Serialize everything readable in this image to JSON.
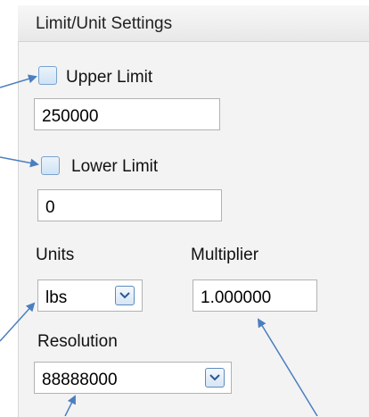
{
  "panel": {
    "title": "Limit/Unit Settings"
  },
  "upper_limit": {
    "label": "Upper Limit",
    "value": "250000",
    "checked": false
  },
  "lower_limit": {
    "label": "Lower Limit",
    "value": "0",
    "checked": false
  },
  "units": {
    "label": "Units",
    "selected": "lbs"
  },
  "multiplier": {
    "label": "Multiplier",
    "value": "1.000000"
  },
  "resolution": {
    "label": "Resolution",
    "selected": "88888000"
  },
  "colors": {
    "arrow": "#4a7fc0",
    "panel_bg": "#f3f3f3",
    "checkbox_border": "#7aa3cf"
  },
  "icons": {
    "dropdown": "chevron-down-icon"
  }
}
